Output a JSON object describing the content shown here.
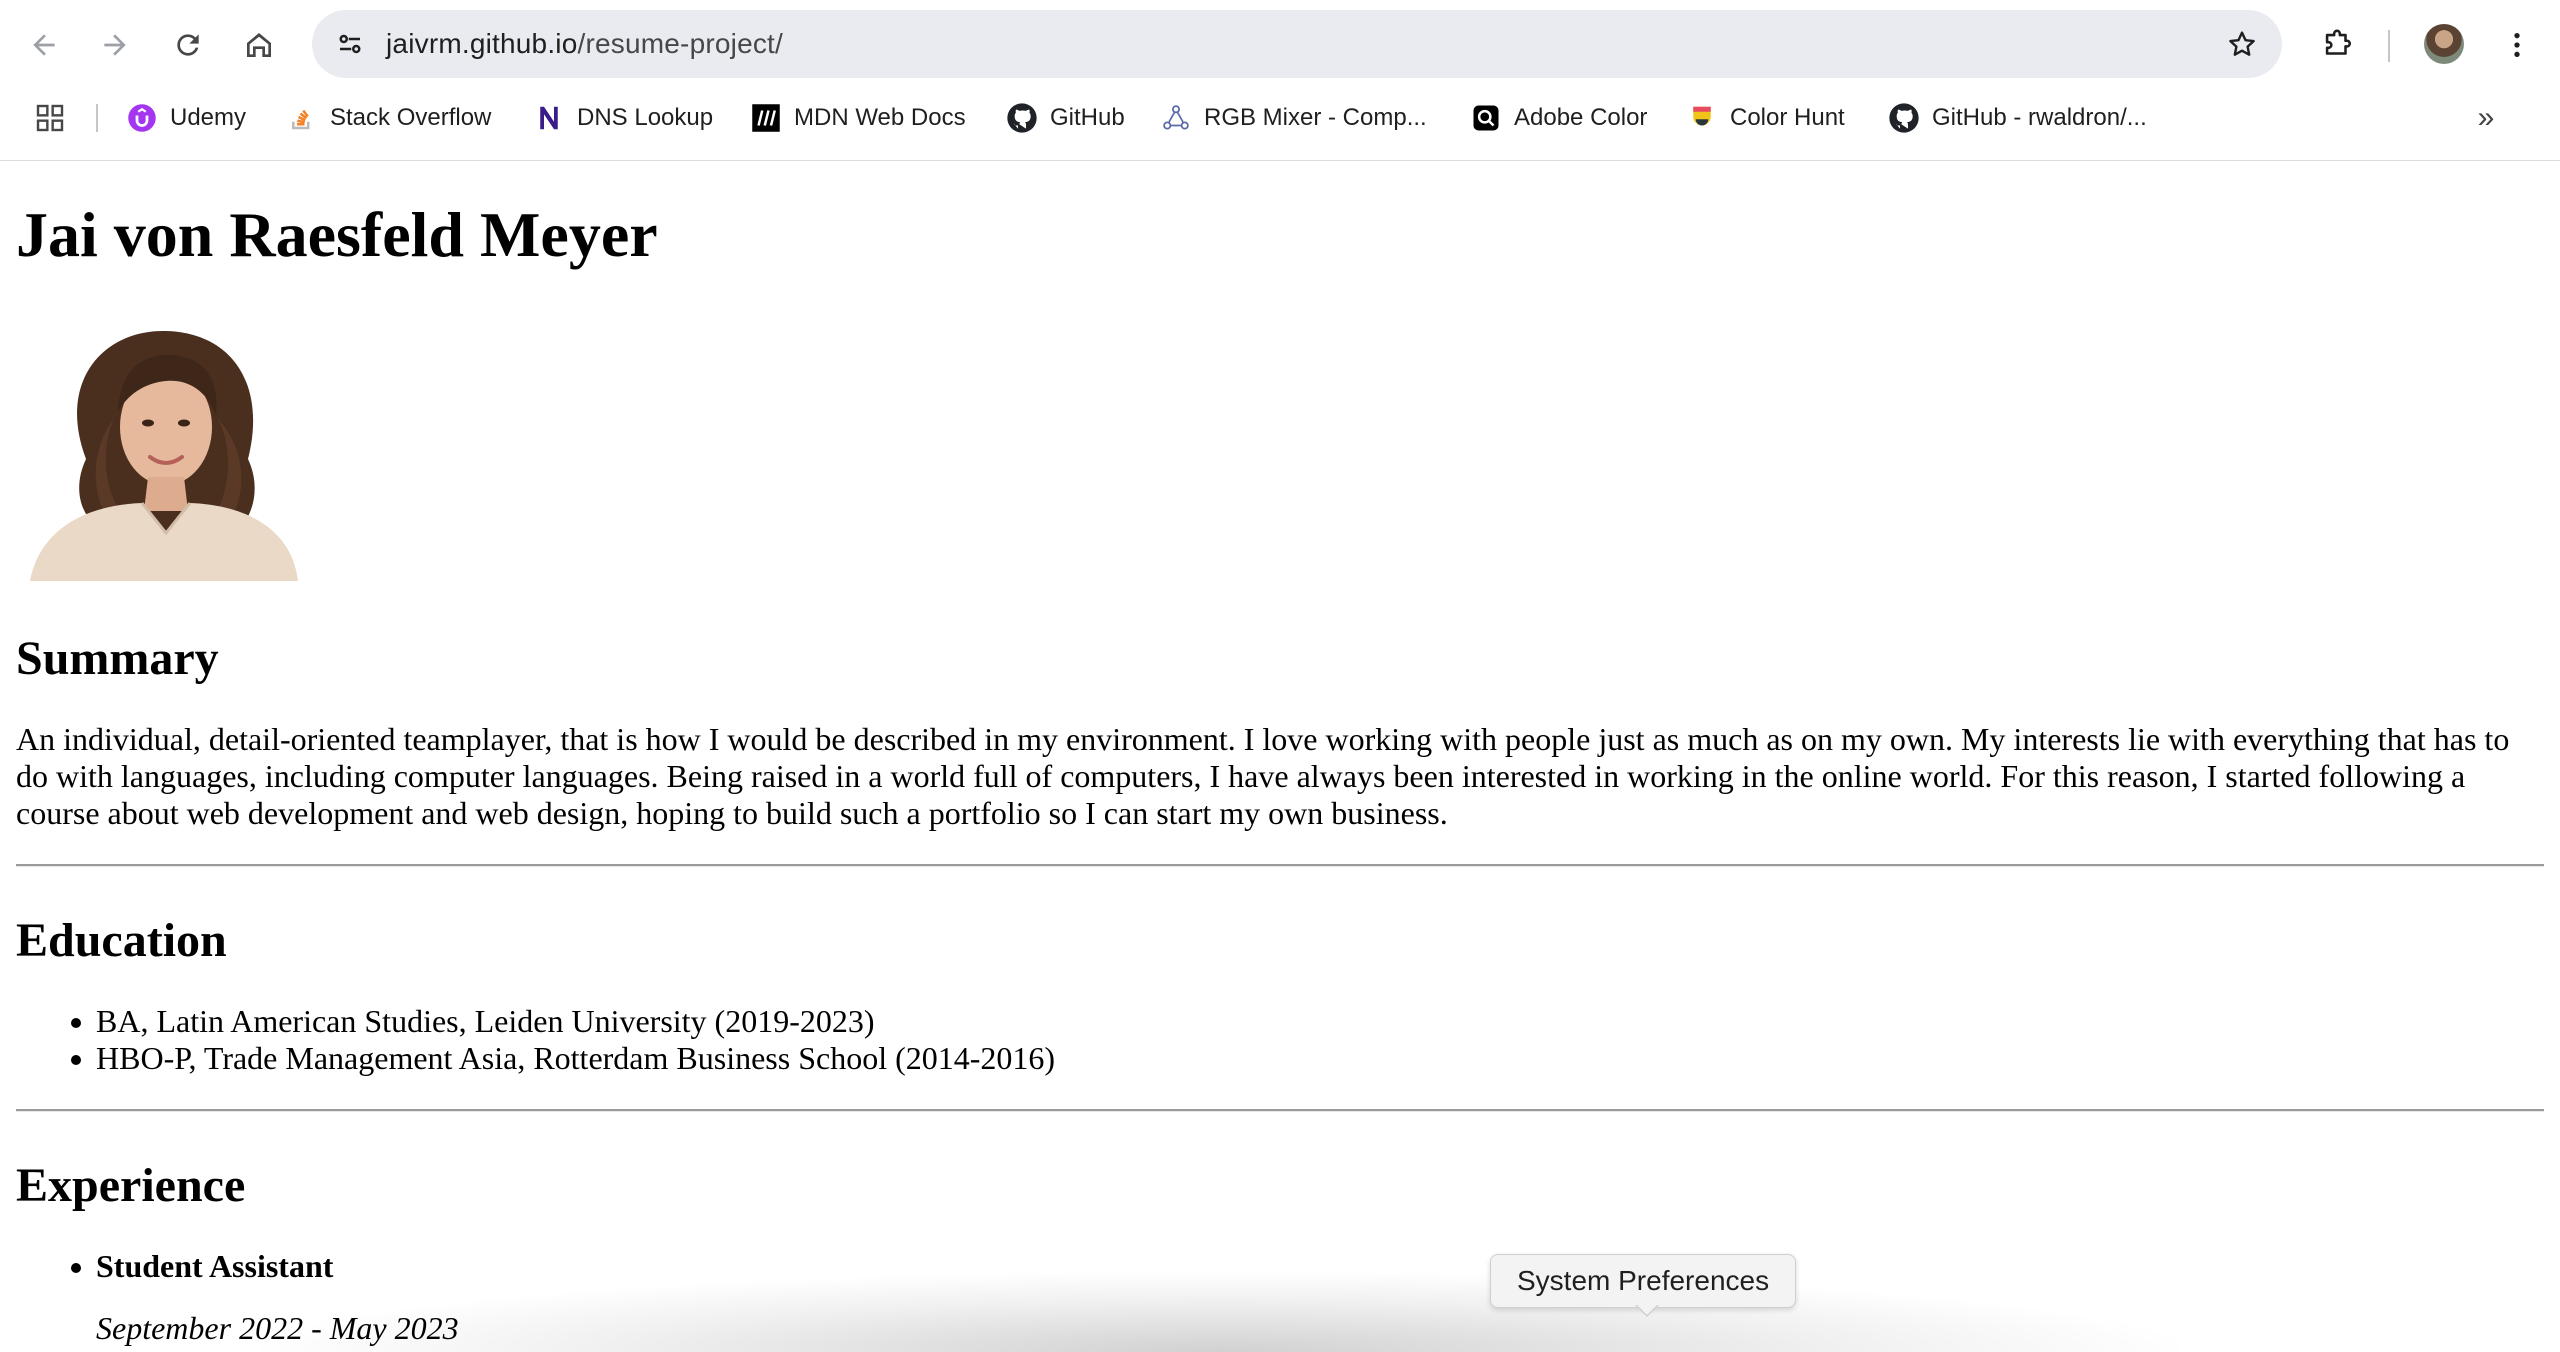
{
  "browser": {
    "url_host": "jaivrm.github.io",
    "url_path": "/resume-project/",
    "icons": {
      "back": "arrow-left-icon",
      "forward": "arrow-right-icon",
      "reload": "reload-icon",
      "home": "home-icon",
      "site_info": "tune-icon",
      "bookmark": "star-icon",
      "extensions": "puzzle-icon",
      "menu": "kebab-menu-icon"
    },
    "bookmarks": [
      {
        "label": "Udemy",
        "icon": "udemy-icon"
      },
      {
        "label": "Stack Overflow",
        "icon": "stackoverflow-icon"
      },
      {
        "label": "DNS Lookup",
        "icon": "dns-lookup-icon"
      },
      {
        "label": "MDN Web Docs",
        "icon": "mdn-icon"
      },
      {
        "label": "GitHub",
        "icon": "github-icon"
      },
      {
        "label": "RGB Mixer - Comp...",
        "icon": "rgb-mixer-icon"
      },
      {
        "label": "Adobe Color",
        "icon": "adobe-color-icon"
      },
      {
        "label": "Color Hunt",
        "icon": "color-hunt-icon"
      },
      {
        "label": "GitHub - rwaldron/...",
        "icon": "github-icon"
      }
    ],
    "more_bookmarks": "»"
  },
  "resume": {
    "name": "Jai von Raesfeld Meyer",
    "summary_heading": "Summary",
    "summary_text": "An individual, detail-oriented teamplayer, that is how I would be described in my environment. I love working with people just as much as on my own. My interests lie with everything that has to do with languages, including computer languages. Being raised in a world full of computers, I have always been interested in working in the online world. For this reason, I started following a course about web development and web design, hoping to build such a portfolio so I can start my own business.",
    "education_heading": "Education",
    "education": [
      "BA, Latin American Studies, Leiden University (2019-2023)",
      "HBO-P, Trade Management Asia, Rotterdam Business School (2014-2016)"
    ],
    "experience_heading": "Experience",
    "experience": [
      {
        "title": "Student Assistant",
        "dates": "September 2022 - May 2023"
      }
    ]
  },
  "overlay": {
    "tooltip": "System Preferences"
  },
  "colors": {
    "omnibox_bg": "#e9ebf0",
    "hr": "#9b9b9b",
    "udemy": "#a435f0",
    "stackoverflow": "#f48024",
    "dns_lookup": "#3b1a8a"
  }
}
